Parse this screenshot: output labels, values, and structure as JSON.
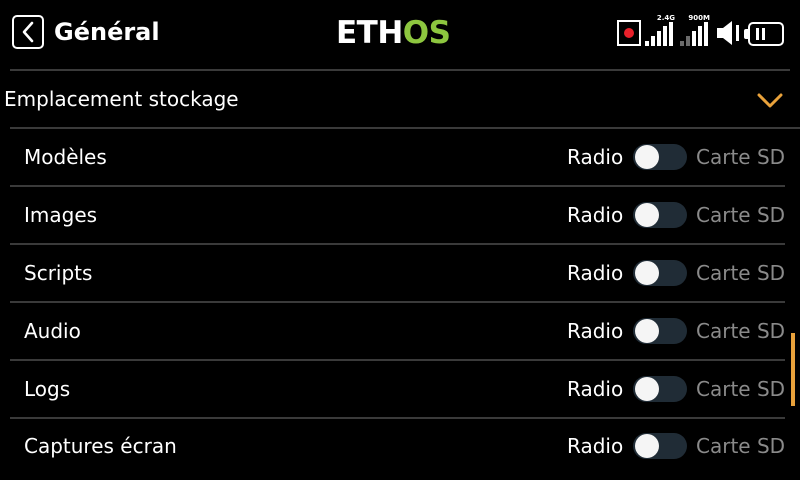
{
  "header": {
    "title": "Général",
    "logo_left": "ETH",
    "logo_right": "OS",
    "rec_color": "#e8202a",
    "signal_24": {
      "label": "2.4G",
      "bars": 5,
      "active": 5
    },
    "signal_900": {
      "label": "900M",
      "bars": 5,
      "active": 3
    },
    "volume_icon": "speaker-icon",
    "battery_icon": "battery-icon"
  },
  "section": {
    "title": "Emplacement stockage",
    "expand_icon": "chevron-down-icon"
  },
  "toggle_labels": {
    "left": "Radio",
    "right": "Carte SD"
  },
  "rows": [
    {
      "label": "Modèles",
      "value": "Radio"
    },
    {
      "label": "Images",
      "value": "Radio"
    },
    {
      "label": "Scripts",
      "value": "Radio"
    },
    {
      "label": "Audio",
      "value": "Radio"
    },
    {
      "label": "Logs",
      "value": "Radio"
    },
    {
      "label": "Captures écran",
      "value": "Radio"
    }
  ],
  "colors": {
    "accent": "#e9a23b",
    "logo_green": "#8dc63f",
    "toggle_track": "#202c36",
    "muted_text": "#8a8a8a"
  }
}
